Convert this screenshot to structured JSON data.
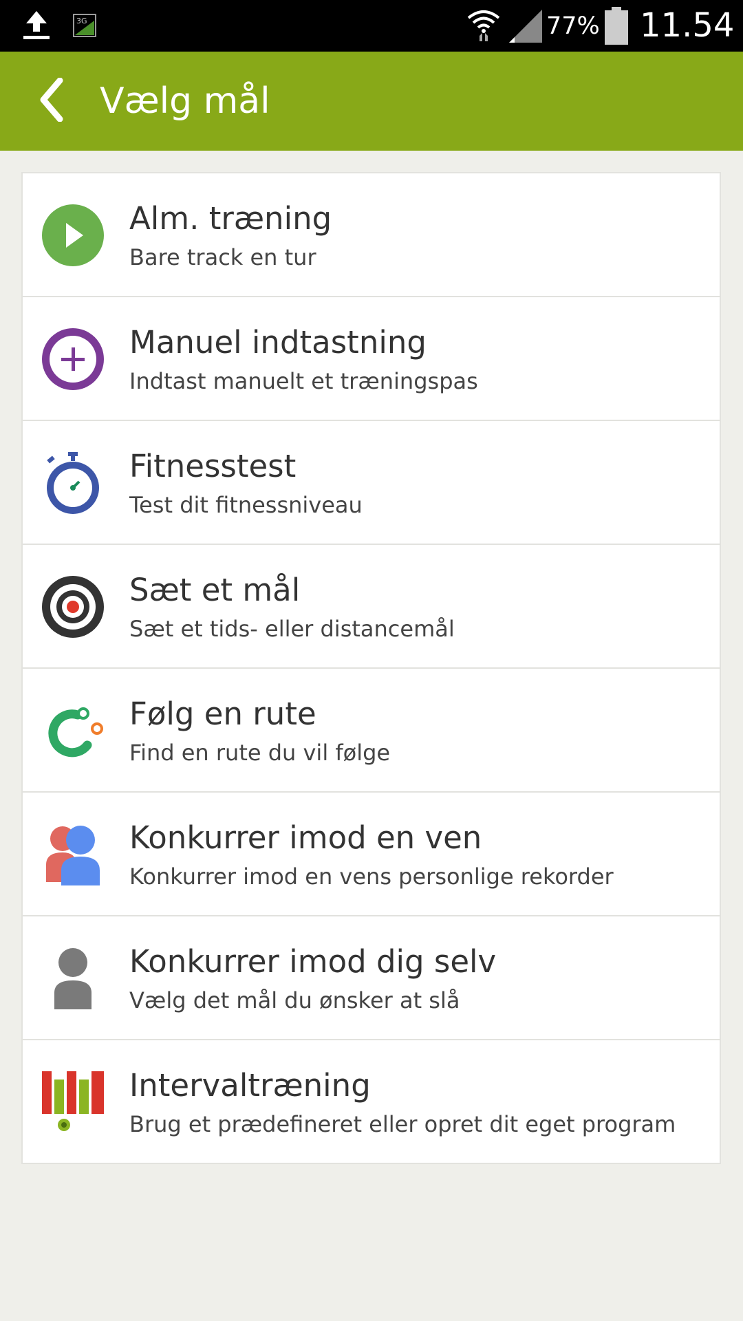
{
  "status_bar": {
    "battery_percent": "77%",
    "time": "11.54",
    "icons": [
      "upload-icon",
      "3g-data-icon",
      "wifi-icon",
      "signal-icon",
      "battery-icon"
    ]
  },
  "app_bar": {
    "title": "Vælg mål",
    "back_icon": "chevron-left-icon",
    "color": "#88a918"
  },
  "items": [
    {
      "title": "Alm. træning",
      "subtitle": "Bare track en tur",
      "icon": "play-icon",
      "color": "#6ab04c"
    },
    {
      "title": "Manuel indtastning",
      "subtitle": "Indtast manuelt et træningspas",
      "icon": "plus-circle-icon",
      "color": "#7b3a96"
    },
    {
      "title": "Fitnesstest",
      "subtitle": "Test dit fitnessniveau",
      "icon": "stopwatch-icon",
      "color": "#3d56a8"
    },
    {
      "title": "Sæt et mål",
      "subtitle": "Sæt et tids- eller distancemål",
      "icon": "target-icon",
      "color": "#333333"
    },
    {
      "title": "Følg en rute",
      "subtitle": "Find en rute du vil følge",
      "icon": "route-icon",
      "color": "#2fa864"
    },
    {
      "title": "Konkurrer imod en ven",
      "subtitle": "Konkurrer imod en vens personlige rekorder",
      "icon": "friends-icon",
      "color": "#5b8def"
    },
    {
      "title": "Konkurrer imod dig selv",
      "subtitle": "Vælg det mål du ønsker at slå",
      "icon": "person-icon",
      "color": "#7a7a7a"
    },
    {
      "title": "Intervaltræning",
      "subtitle": "Brug et prædefineret eller opret dit eget program",
      "icon": "interval-bars-icon",
      "color": "#d9342b"
    }
  ]
}
